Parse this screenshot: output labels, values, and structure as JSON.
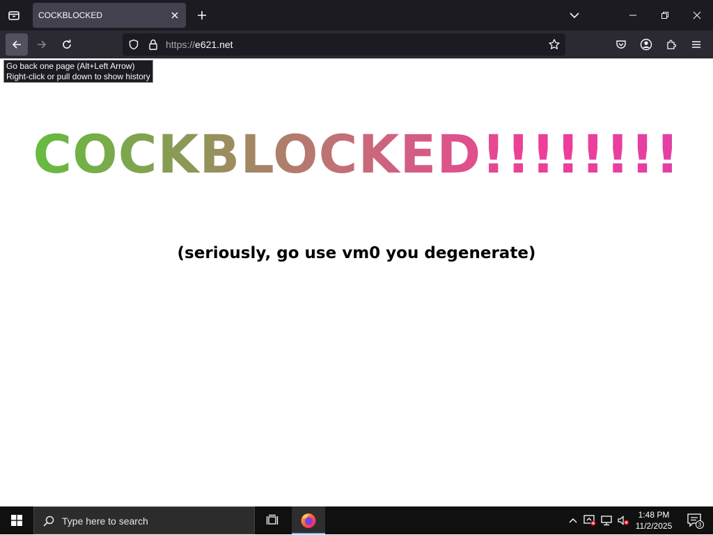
{
  "browser": {
    "tab_title": "COCKBLOCKED",
    "url_scheme": "https://",
    "url_host": "e621.net",
    "tooltip_line1": "Go back one page (Alt+Left Arrow)",
    "tooltip_line2": "Right-click or pull down to show history",
    "icons": [
      "firefox-view-icon",
      "close-icon",
      "plus-icon",
      "chevron-down-icon",
      "minimize-icon",
      "restore-icon",
      "back-arrow-icon",
      "forward-arrow-icon",
      "reload-icon",
      "shield-icon",
      "lock-icon",
      "star-icon",
      "pocket-icon",
      "account-icon",
      "extensions-icon",
      "menu-icon"
    ]
  },
  "page": {
    "heading": "COCKBLOCKED!!!!!!!!",
    "heading_gradient": [
      "#5dc43a",
      "#8a9a55",
      "#c76b7a",
      "#ee3e98",
      "#e040a8"
    ],
    "subtitle": "(seriously, go use vm0 you degenerate)"
  },
  "taskbar": {
    "search_placeholder": "Type here to search",
    "time": "1:48 PM",
    "date": "11/2/2025",
    "notification_count": "3"
  },
  "colors": {
    "tabstrip": "#1c1b22",
    "toolbar": "#2b2a33",
    "taskbar": "#101010"
  }
}
